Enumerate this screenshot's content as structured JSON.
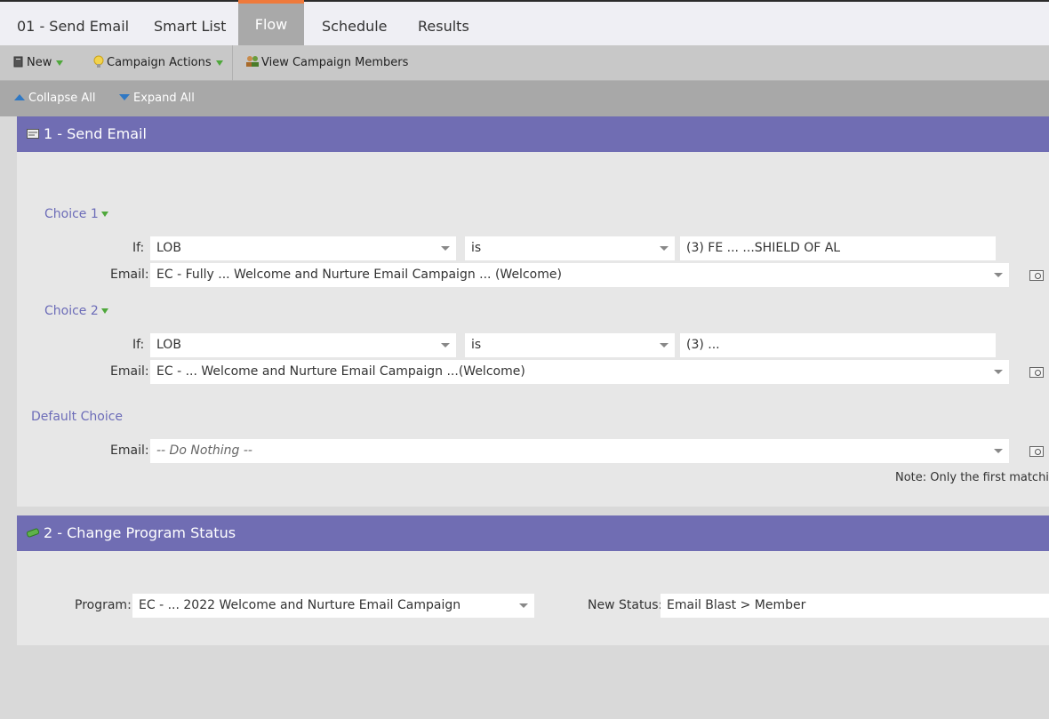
{
  "tabs": [
    "01 - Send Email",
    "Smart List",
    "Flow",
    "Schedule",
    "Results"
  ],
  "toolbar": {
    "new_label": "New",
    "campaign_actions_label": "Campaign Actions",
    "view_members_label": "View Campaign Members"
  },
  "subbar": {
    "collapse_label": "Collapse All",
    "expand_label": "Expand All"
  },
  "step1": {
    "title": "1 - Send Email",
    "choices": [
      {
        "label": "Choice 1",
        "if_label": "If:",
        "field": "LOB",
        "operator": "is",
        "value": "(3) FE ...  ...SHIELD OF AL",
        "email_label": "Email:",
        "email": "EC - Fully ...   Welcome and Nurture Email Campaign ...  (Welcome)"
      },
      {
        "label": "Choice 2",
        "if_label": "If:",
        "field": "LOB",
        "operator": "is",
        "value": "(3) ...",
        "email_label": "Email:",
        "email": "EC - ...  Welcome and Nurture Email Campaign ...(Welcome)"
      }
    ],
    "default_label": "Default Choice",
    "default_email_label": "Email:",
    "default_email": "-- Do Nothing --",
    "note": "Note: Only the first matching"
  },
  "step2": {
    "title": "2 - Change Program Status",
    "program_label": "Program:",
    "program_value": "EC - ...  2022 Welcome and Nurture Email Campaign",
    "status_label": "New Status:",
    "status_value": "Email Blast > Member"
  },
  "colors": {
    "header_purple": "#706db3",
    "active_tab_accent": "#ef7a3c",
    "choice_label": "#6c6cb8"
  }
}
